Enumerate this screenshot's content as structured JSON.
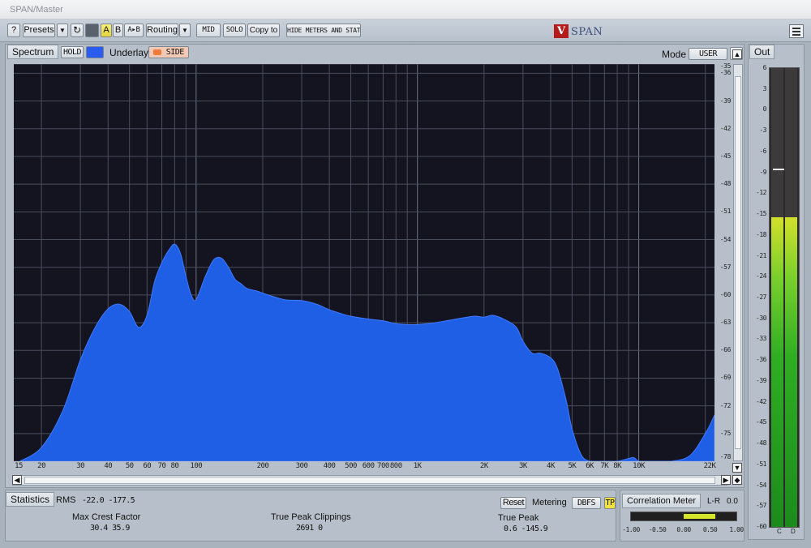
{
  "window": {
    "title": "SPAN/Master"
  },
  "toolbar": {
    "help": "?",
    "presets": "Presets",
    "a": "A",
    "b": "B",
    "a_to_b": "A▸B",
    "routing": "Routing",
    "mid": "MID",
    "solo": "SOLO",
    "copy_to": "Copy to",
    "hide_meters": "HIDE METERS AND STATS",
    "brand": "SPAN",
    "brand_mark": "V"
  },
  "spectrum": {
    "tab": "Spectrum",
    "hold": "HOLD",
    "underlay": "Underlay",
    "side": "SIDE",
    "mode_label": "Mode",
    "mode_value": "USER",
    "colors": {
      "fill": "#1f5fe6",
      "background": "#141421",
      "hold_swatch": "#2a5cf0",
      "side": "#f07b3b"
    }
  },
  "chart_data": {
    "type": "area",
    "title": "",
    "xlabel": "",
    "ylabel": "",
    "x_scale": "log",
    "xlim": [
      15,
      22000
    ],
    "ylim": [
      -78,
      -35
    ],
    "x_tick_labels": [
      "15",
      "20",
      "30",
      "40",
      "50",
      "60",
      "70",
      "80",
      "100",
      "200",
      "300",
      "400",
      "500",
      "600",
      "700",
      "800",
      "1K",
      "2K",
      "3K",
      "4K",
      "5K",
      "6K",
      "7K",
      "8K",
      "10K",
      "22K"
    ],
    "x_tick_values": [
      15,
      20,
      30,
      40,
      50,
      60,
      70,
      80,
      100,
      200,
      300,
      400,
      500,
      600,
      700,
      800,
      1000,
      2000,
      3000,
      4000,
      5000,
      6000,
      7000,
      8000,
      10000,
      22000
    ],
    "y_tick_labels": [
      "-35",
      "-36",
      "-39",
      "-42",
      "-45",
      "-48",
      "-51",
      "-54",
      "-57",
      "-60",
      "-63",
      "-66",
      "-69",
      "-72",
      "-75",
      "-78"
    ],
    "y_tick_values": [
      -35,
      -36,
      -39,
      -42,
      -45,
      -48,
      -51,
      -54,
      -57,
      -60,
      -63,
      -66,
      -69,
      -72,
      -75,
      -78
    ],
    "grid": true,
    "series": [
      {
        "x": [
          16,
          20,
          25,
          30,
          35,
          40,
          45,
          50,
          55,
          60,
          65,
          70,
          75,
          80,
          85,
          90,
          95,
          100,
          110,
          120,
          130,
          140,
          150,
          160,
          170,
          190,
          200,
          250,
          300,
          350,
          400,
          450,
          500,
          600,
          700,
          800,
          900,
          1000,
          1200,
          1500,
          1800,
          2000,
          2200,
          2500,
          2800,
          3000,
          3300,
          3600,
          4000,
          4300,
          4700,
          5000,
          5500,
          6000,
          6500,
          7000,
          8000,
          9000,
          9500,
          10000,
          11000,
          12000,
          14000,
          17000,
          20000,
          22000
        ],
        "y": [
          -78,
          -76.5,
          -72.5,
          -67,
          -63.5,
          -61.5,
          -61,
          -61.8,
          -63.5,
          -62.2,
          -58.5,
          -56.5,
          -55.2,
          -54.5,
          -55.5,
          -58,
          -60,
          -60.5,
          -58,
          -56.2,
          -56,
          -57,
          -58.3,
          -58.8,
          -59.3,
          -59.6,
          -59.8,
          -60.5,
          -60.6,
          -61,
          -61.6,
          -62,
          -62.3,
          -62.6,
          -62.8,
          -63.1,
          -63.2,
          -63.2,
          -63,
          -62.6,
          -62.3,
          -62.4,
          -62.2,
          -62.7,
          -63.5,
          -65,
          -66.3,
          -66.3,
          -66.8,
          -68,
          -71.4,
          -74.5,
          -77.3,
          -78,
          -78,
          -78,
          -78,
          -77.7,
          -77.6,
          -78,
          -78,
          -78,
          -78,
          -77.4,
          -75,
          -73
        ]
      }
    ]
  },
  "statistics": {
    "tab": "Statistics",
    "rms_label": "RMS",
    "rms_values": "-22.0  -177.5",
    "max_crest_label": "Max Crest Factor",
    "max_crest_values": "30.4   35.9",
    "true_peak_clippings_label": "True Peak Clippings",
    "true_peak_clippings_values": "2691     0",
    "reset": "Reset",
    "metering_label": "Metering",
    "dbfs": "DBFS",
    "tp": "TP",
    "true_peak_label": "True Peak",
    "true_peak_values": "0.6  -145.9"
  },
  "correlation": {
    "title": "Correlation Meter",
    "lr_label": "L-R",
    "lr_value": "0.0",
    "ticks": [
      "-1.00",
      "-0.50",
      "0.00",
      "0.50",
      "1.00"
    ],
    "tick_values": [
      -1,
      -0.5,
      0,
      0.5,
      1
    ],
    "fill_from": 0,
    "fill_to": 0.6,
    "fill_color": "#d5e52a"
  },
  "output": {
    "tab": "Out",
    "scale": [
      "6",
      "3",
      "0",
      "-3",
      "-6",
      "-9",
      "-12",
      "-15",
      "-18",
      "-21",
      "-24",
      "-27",
      "-30",
      "-33",
      "-36",
      "-39",
      "-42",
      "-45",
      "-48",
      "-51",
      "-54",
      "-57",
      "-60"
    ],
    "scale_values": [
      6,
      3,
      0,
      -3,
      -6,
      -9,
      -12,
      -15,
      -18,
      -21,
      -24,
      -27,
      -30,
      -33,
      -36,
      -39,
      -42,
      -45,
      -48,
      -51,
      -54,
      -57,
      -60
    ],
    "range_db": [
      -60,
      6
    ],
    "peak_db": -8.5,
    "left_level_db": -15.5,
    "right_level_db": -15.5,
    "channels": [
      "C",
      "D"
    ]
  }
}
